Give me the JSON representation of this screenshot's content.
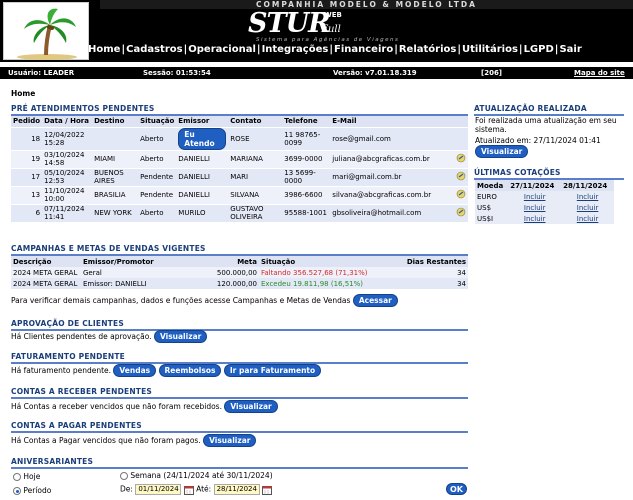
{
  "header": {
    "company": "COMPANHIA MODELO & MODELO LTDA",
    "brand": "STUR",
    "brand_web": "WEB",
    "brand_full": "Full",
    "slogan": "Sistema para Agências de Viagens",
    "menu": [
      "Home",
      "Cadastros",
      "Operacional",
      "Integrações",
      "Financeiro",
      "Relatórios",
      "Utilitários",
      "LGPD",
      "Sair"
    ]
  },
  "infobar": {
    "user_label": "Usuário: LEADER",
    "session_label": "Sessão: 01:53:54",
    "version_label": "Versão: v7.01.18.319",
    "code": "[206]",
    "sitemap": "Mapa do site"
  },
  "breadcrumb": "Home",
  "pending": {
    "title": "PRÉ ATENDIMENTOS PENDENTES",
    "columns": [
      "Pedido",
      "Data / Hora",
      "Destino",
      "Situação",
      "Emissor",
      "Contato",
      "Telefone",
      "E-Mail"
    ],
    "rows": [
      {
        "pedido": "18",
        "data": "12/04/2022 15:28",
        "destino": "",
        "situacao": "Aberto",
        "emissor": "Eu Atendo",
        "emissor_button": true,
        "contato": "ROSE",
        "telefone": "11 98765-0099",
        "email": "rose@gmail.com",
        "icon": false
      },
      {
        "pedido": "19",
        "data": "03/10/2024 14:58",
        "destino": "MIAMI",
        "situacao": "Aberto",
        "emissor": "DANIELLI",
        "emissor_button": false,
        "contato": "MARIANA",
        "telefone": "3699-0000",
        "email": "juliana@abcgraficas.com.br",
        "icon": true
      },
      {
        "pedido": "17",
        "data": "05/10/2024 12:53",
        "destino": "BUENOS AIRES",
        "situacao": "Pendente",
        "emissor": "DANIELLI",
        "emissor_button": false,
        "contato": "MARI",
        "telefone": "13 5699-0000",
        "email": "mari@gmail.com.br",
        "icon": true
      },
      {
        "pedido": "13",
        "data": "11/10/2024 10:00",
        "destino": "BRASILIA",
        "situacao": "Pendente",
        "emissor": "DANIELLI",
        "emissor_button": false,
        "contato": "SILVANA",
        "telefone": "3986-6600",
        "email": "silvana@abcgraficas.com.br",
        "icon": true
      },
      {
        "pedido": "6",
        "data": "07/11/2024 11:41",
        "destino": "NEW YORK",
        "situacao": "Aberto",
        "emissor": "MURILO",
        "emissor_button": false,
        "contato": "GUSTAVO OLIVEIRA",
        "telefone": "95588-1001",
        "email": "gbsoliveira@hotmail.com",
        "icon": true
      }
    ]
  },
  "campaigns": {
    "title": "CAMPANHAS E METAS DE VENDAS VIGENTES",
    "columns": [
      "Descrição",
      "Emissor/Promotor",
      "Meta",
      "Situação",
      "Dias Restantes"
    ],
    "rows": [
      {
        "descricao": "2024 META GERAL",
        "emissor": "Geral",
        "meta": "500.000,00",
        "situacao": "Faltando 356.527,68 (71,31%)",
        "status": "red",
        "dias": "34"
      },
      {
        "descricao": "2024 META GERAL",
        "emissor": "Emissor: DANIELLI",
        "meta": "120.000,00",
        "situacao": "Excedeu 19.811,98 (16,51%)",
        "status": "green",
        "dias": "34"
      }
    ],
    "note": "Para verificar demais campanhas, dados e funções acesse Campanhas e Metas de Vendas",
    "button": "Acessar"
  },
  "aprovacao": {
    "title": "APROVAÇÃO DE CLIENTES",
    "text": "Há Clientes pendentes de aprovação.",
    "button": "Visualizar"
  },
  "faturamento": {
    "title": "FATURAMENTO PENDENTE",
    "text": "Há faturamento pendente.",
    "buttons": [
      "Vendas",
      "Reembolsos",
      "Ir para Faturamento"
    ]
  },
  "receber": {
    "title": "CONTAS A RECEBER PENDENTES",
    "text": "Há Contas a receber vencidos que não foram recebidos.",
    "button": "Visualizar"
  },
  "pagar": {
    "title": "CONTAS A PAGAR PENDENTES",
    "text": "Há Contas a Pagar vencidos que não foram pagos.",
    "button": "Visualizar"
  },
  "aniversariantes": {
    "title": "ANIVERSARIANTES",
    "options": {
      "hoje": "Hoje",
      "periodo": "Período",
      "semana": "Semana (24/11/2024 até 30/11/2024)"
    },
    "selected": "periodo",
    "de_label": "De:",
    "ate_label": "Até:",
    "de_value": "01/11/2024",
    "ate_value": "28/11/2024",
    "ok": "OK"
  },
  "atualizacao": {
    "title": "ATUALIZAÇÃO REALIZADA",
    "text1": "Foi realizada uma atualização em seu",
    "text2": "sistema.",
    "text3": "Atualizado em: 27/11/2024 01:41",
    "button": "Visualizar"
  },
  "cotacoes": {
    "title": "ÚLTIMAS COTAÇÕES",
    "columns": [
      "Moeda",
      "27/11/2024",
      "28/11/2024"
    ],
    "rows": [
      {
        "moeda": "EURO",
        "d1": "Incluir",
        "d2": "Incluir"
      },
      {
        "moeda": "US$",
        "d1": "Incluir",
        "d2": "Incluir"
      },
      {
        "moeda": "US$I",
        "d1": "Incluir",
        "d2": "Incluir"
      }
    ]
  }
}
